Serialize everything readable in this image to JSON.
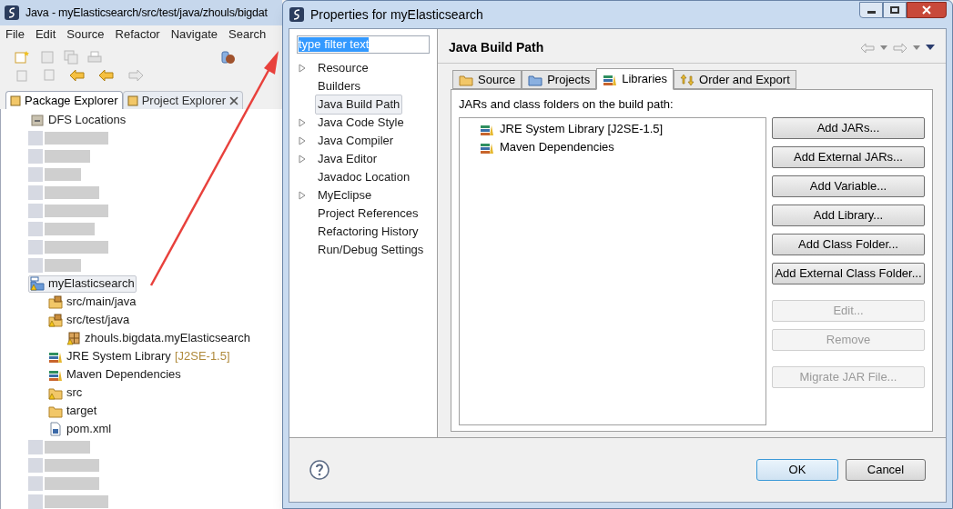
{
  "ide": {
    "title": "Java - myElasticsearch/src/test/java/zhouls/bigdat",
    "menu": [
      "File",
      "Edit",
      "Source",
      "Refactor",
      "Navigate",
      "Search"
    ],
    "tabs": [
      {
        "label": "Package Explorer",
        "selected": true
      },
      {
        "label": "Project Explorer",
        "selected": false
      }
    ],
    "tree": [
      {
        "label": "DFS Locations",
        "kind": "server",
        "selected": false,
        "warning": false
      },
      {
        "label": "myElasticsearch",
        "kind": "project",
        "selected": true,
        "warning": true,
        "children": [
          {
            "label": "src/main/java",
            "kind": "source-folder",
            "selected": false,
            "warning": false
          },
          {
            "label": "src/test/java",
            "kind": "source-folder",
            "selected": false,
            "warning": true,
            "children": [
              {
                "label": "zhouls.bigdata.myElasticsearch",
                "kind": "package",
                "selected": false,
                "warning": true
              }
            ]
          },
          {
            "label": "JRE System Library",
            "decoration": "[J2SE-1.5]",
            "kind": "library",
            "selected": false,
            "warning": false
          },
          {
            "label": "Maven Dependencies",
            "kind": "library",
            "selected": false,
            "warning": false
          },
          {
            "label": "src",
            "kind": "folder",
            "selected": false,
            "warning": true
          },
          {
            "label": "target",
            "kind": "folder",
            "selected": false,
            "warning": false
          },
          {
            "label": "pom.xml",
            "kind": "file",
            "selected": false,
            "warning": false
          }
        ]
      }
    ]
  },
  "dialog": {
    "title": "Properties for myElasticsearch",
    "filter": {
      "value": "type filter text",
      "text_selected": true
    },
    "nav": [
      {
        "label": "Resource",
        "has_children": true,
        "selected": false
      },
      {
        "label": "Builders",
        "has_children": false,
        "selected": false
      },
      {
        "label": "Java Build Path",
        "has_children": false,
        "selected": true
      },
      {
        "label": "Java Code Style",
        "has_children": true,
        "selected": false
      },
      {
        "label": "Java Compiler",
        "has_children": true,
        "selected": false
      },
      {
        "label": "Java Editor",
        "has_children": true,
        "selected": false
      },
      {
        "label": "Javadoc Location",
        "has_children": false,
        "selected": false
      },
      {
        "label": "MyEclipse",
        "has_children": true,
        "selected": false
      },
      {
        "label": "Project References",
        "has_children": false,
        "selected": false
      },
      {
        "label": "Refactoring History",
        "has_children": false,
        "selected": false
      },
      {
        "label": "Run/Debug Settings",
        "has_children": false,
        "selected": false
      }
    ],
    "page_title": "Java Build Path",
    "tabs": [
      {
        "label": "Source",
        "kind": "source",
        "selected": false
      },
      {
        "label": "Projects",
        "kind": "projects",
        "selected": false
      },
      {
        "label": "Libraries",
        "kind": "libraries",
        "selected": true
      },
      {
        "label": "Order and Export",
        "kind": "order",
        "selected": false
      }
    ],
    "description": "JARs and class folders on the build path:",
    "entries": [
      "JRE System Library [J2SE-1.5]",
      "Maven Dependencies"
    ],
    "button_groups": [
      [
        {
          "label": "Add JARs...",
          "disabled": false
        },
        {
          "label": "Add External JARs...",
          "disabled": false
        },
        {
          "label": "Add Variable...",
          "disabled": false
        },
        {
          "label": "Add Library...",
          "disabled": false
        },
        {
          "label": "Add Class Folder...",
          "disabled": false
        },
        {
          "label": "Add External Class Folder...",
          "disabled": false
        }
      ],
      [
        {
          "label": "Edit...",
          "disabled": true
        },
        {
          "label": "Remove",
          "disabled": true
        }
      ],
      [
        {
          "label": "Migrate JAR File...",
          "disabled": true
        }
      ]
    ],
    "footer_buttons": [
      {
        "label": "OK",
        "default": true
      },
      {
        "label": "Cancel",
        "default": false
      }
    ]
  }
}
